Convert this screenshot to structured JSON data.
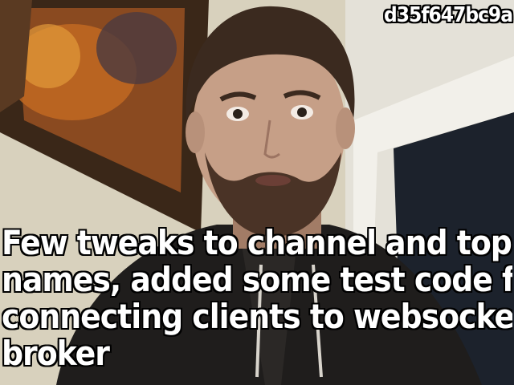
{
  "frame_id": "d35f647bc9a",
  "caption_lines": [
    "Few tweaks to channel and topic",
    "names, added some test code for",
    "connecting clients to websocket",
    "broker"
  ]
}
